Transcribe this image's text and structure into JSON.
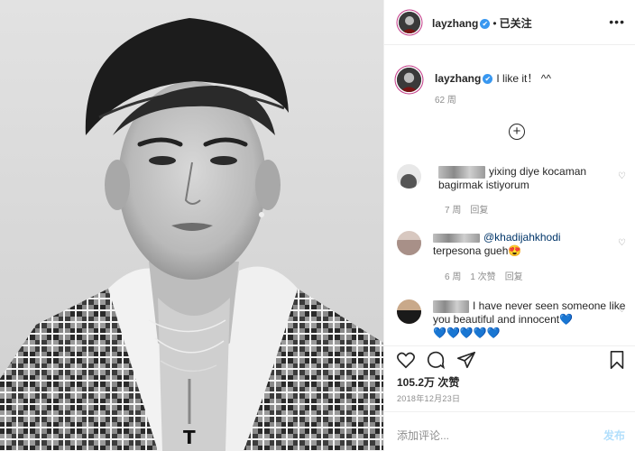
{
  "post": {
    "photo_label": "post-photo"
  },
  "header": {
    "username": "layzhang",
    "verified_glyph": "✔",
    "separator": "•",
    "follow_status": "已关注",
    "more_glyph": "•••",
    "avatar_icon": "avatar-icon"
  },
  "caption": {
    "username": "layzhang",
    "verified_glyph": "✔",
    "text": "I like it！ ^^",
    "time": "62 周"
  },
  "load_more": {
    "glyph": "+"
  },
  "comments": [
    {
      "text": "yixing diye kocaman bagirmak istiyorum",
      "time": "7 周",
      "reply": "回复",
      "likes": "",
      "heart": "♡"
    },
    {
      "mention": "@khadijahkhodi",
      "text": "terpesona gueh😍",
      "time": "6 周",
      "likes": "1 次赞",
      "reply": "回复",
      "heart": "♡"
    },
    {
      "text": "I have never seen someone like you beautiful and innocent💙",
      "extra": "💙💙💙💙💙",
      "heart": "♡"
    }
  ],
  "actions": {
    "like_icon": "heart-icon",
    "comment_icon": "comment-icon",
    "share_icon": "share-icon",
    "save_icon": "bookmark-icon"
  },
  "likes": "105.2万 次赞",
  "date": "2018年12月23日",
  "add_comment": {
    "placeholder": "添加评论...",
    "post_label": "发布"
  },
  "colors": {
    "accent": "#3897f0",
    "post_disabled": "#b2dffc",
    "muted": "#8e8e8e",
    "text": "#262626"
  }
}
